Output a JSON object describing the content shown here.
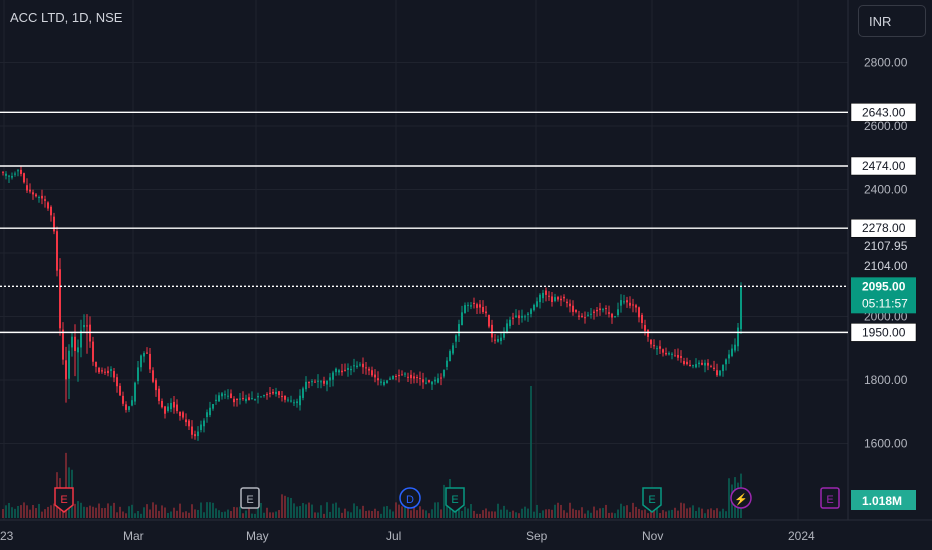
{
  "header": {
    "symbol_title": "ACC LTD, 1D, NSE",
    "currency_button": "INR"
  },
  "chart_data": {
    "type": "candlestick",
    "title": "ACC LTD, 1D, NSE",
    "currency": "INR",
    "ylim": [
      1480,
      2880
    ],
    "y_ticks": [
      "2800.00",
      "2600.00",
      "2400.00",
      "2000.00",
      "1800.00",
      "1600.00"
    ],
    "x_ticks": [
      "23",
      "Mar",
      "May",
      "Jul",
      "Sep",
      "Nov",
      "2024"
    ],
    "horizontal_lines": [
      {
        "value": 2643,
        "label": "2643.00"
      },
      {
        "value": 2474,
        "label": "2474.00"
      },
      {
        "value": 2278,
        "label": "2278.00"
      },
      {
        "value": 2095,
        "label": "2095.00"
      },
      {
        "value": 1950,
        "label": "1950.00"
      }
    ],
    "price_labels": [
      {
        "value": 2107.95,
        "label": "2107.95"
      },
      {
        "value": 2104,
        "label": "2104.00"
      }
    ],
    "last_price": {
      "value": 2095,
      "label": "2095.00",
      "countdown": "05:11:57"
    },
    "volume_label": "1.018M",
    "event_markers": [
      {
        "symbol": "E",
        "date": "Feb",
        "color": "#f23645"
      },
      {
        "symbol": "E",
        "date": "Apr",
        "color": "#b2b5be"
      },
      {
        "symbol": "D",
        "date": "Jul",
        "color": "#2962ff"
      },
      {
        "symbol": "E",
        "date": "Jul",
        "color": "#089981"
      },
      {
        "symbol": "E",
        "date": "Oct",
        "color": "#089981"
      },
      {
        "symbol": "⚡",
        "date": "Dec",
        "color": "#9c27b0"
      },
      {
        "symbol": "E",
        "date": "Jan 2024",
        "color": "#9c27b0"
      }
    ],
    "close_path": [
      [
        0,
        2450
      ],
      [
        10,
        2440
      ],
      [
        18,
        2470
      ],
      [
        25,
        2400
      ],
      [
        35,
        2380
      ],
      [
        45,
        2360
      ],
      [
        52,
        2300
      ],
      [
        56,
        2150
      ],
      [
        60,
        1900
      ],
      [
        65,
        1800
      ],
      [
        70,
        1960
      ],
      [
        75,
        1870
      ],
      [
        80,
        1960
      ],
      [
        85,
        1990
      ],
      [
        92,
        1860
      ],
      [
        100,
        1820
      ],
      [
        110,
        1830
      ],
      [
        118,
        1760
      ],
      [
        124,
        1700
      ],
      [
        130,
        1720
      ],
      [
        138,
        1860
      ],
      [
        145,
        1900
      ],
      [
        150,
        1820
      ],
      [
        157,
        1750
      ],
      [
        163,
        1690
      ],
      [
        170,
        1730
      ],
      [
        177,
        1700
      ],
      [
        185,
        1670
      ],
      [
        193,
        1620
      ],
      [
        200,
        1660
      ],
      [
        210,
        1720
      ],
      [
        220,
        1760
      ],
      [
        228,
        1750
      ],
      [
        235,
        1730
      ],
      [
        240,
        1740
      ],
      [
        250,
        1740
      ],
      [
        257,
        1750
      ],
      [
        265,
        1760
      ],
      [
        275,
        1760
      ],
      [
        285,
        1740
      ],
      [
        295,
        1720
      ],
      [
        305,
        1790
      ],
      [
        315,
        1800
      ],
      [
        325,
        1790
      ],
      [
        335,
        1830
      ],
      [
        345,
        1830
      ],
      [
        355,
        1850
      ],
      [
        365,
        1840
      ],
      [
        372,
        1810
      ],
      [
        380,
        1790
      ],
      [
        390,
        1810
      ],
      [
        400,
        1820
      ],
      [
        410,
        1810
      ],
      [
        420,
        1800
      ],
      [
        430,
        1790
      ],
      [
        440,
        1810
      ],
      [
        448,
        1880
      ],
      [
        455,
        1940
      ],
      [
        462,
        2030
      ],
      [
        470,
        2040
      ],
      [
        478,
        2030
      ],
      [
        485,
        2010
      ],
      [
        492,
        1920
      ],
      [
        500,
        1930
      ],
      [
        508,
        1990
      ],
      [
        518,
        2000
      ],
      [
        528,
        2010
      ],
      [
        536,
        2050
      ],
      [
        543,
        2080
      ],
      [
        550,
        2050
      ],
      [
        556,
        2060
      ],
      [
        565,
        2050
      ],
      [
        572,
        2020
      ],
      [
        580,
        1990
      ],
      [
        588,
        2010
      ],
      [
        596,
        2020
      ],
      [
        605,
        2020
      ],
      [
        612,
        1990
      ],
      [
        620,
        2050
      ],
      [
        628,
        2040
      ],
      [
        636,
        2020
      ],
      [
        643,
        1960
      ],
      [
        650,
        1910
      ],
      [
        658,
        1900
      ],
      [
        668,
        1880
      ],
      [
        678,
        1870
      ],
      [
        688,
        1840
      ],
      [
        698,
        1850
      ],
      [
        708,
        1850
      ],
      [
        716,
        1820
      ],
      [
        724,
        1860
      ],
      [
        730,
        1890
      ],
      [
        735,
        1910
      ],
      [
        738,
        1990
      ],
      [
        741,
        2095
      ]
    ]
  }
}
